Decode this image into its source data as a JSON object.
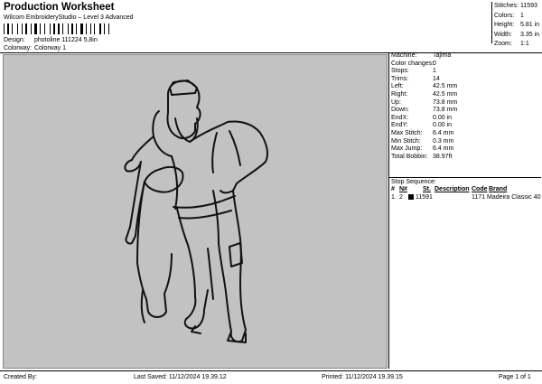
{
  "header": {
    "title": "Production Worksheet",
    "subtitle": "Wilcom EmbroideryStudio – Level 3 Advanced",
    "design_label": "Design:",
    "design_value": "photoline 111224 5,8in",
    "colorway_label": "Colorway:",
    "colorway_value": "Colorway 1"
  },
  "summary": [
    {
      "label": "Stitches:",
      "value": "11593"
    },
    {
      "label": "Colors:",
      "value": "1"
    },
    {
      "label": "Height:",
      "value": "5.81 in"
    },
    {
      "label": "Width:",
      "value": "3.35 in"
    },
    {
      "label": "Zoom:",
      "value": "1:1"
    }
  ],
  "details": [
    {
      "label": "Machine:",
      "value": "Tajima"
    },
    {
      "label": "Color changes:",
      "value": "0"
    },
    {
      "label": "Stops:",
      "value": "1"
    },
    {
      "label": "Trims:",
      "value": "14"
    },
    {
      "label": "Left:",
      "value": "42.5 mm"
    },
    {
      "label": "Right:",
      "value": "42.5 mm"
    },
    {
      "label": "Up:",
      "value": "73.8 mm"
    },
    {
      "label": "Down:",
      "value": "73.8 mm"
    },
    {
      "label": "EndX:",
      "value": "0.00 in"
    },
    {
      "label": "EndY:",
      "value": "0.00 in"
    },
    {
      "label": "Max Stitch:",
      "value": "6.4 mm"
    },
    {
      "label": "Min Stitch:",
      "value": "0.3 mm"
    },
    {
      "label": "Max Jump:",
      "value": "6.4 mm"
    },
    {
      "label": "Total Bobbin:",
      "value": "38.97ft"
    }
  ],
  "stop_sequence": {
    "title": "Stop Sequence:",
    "headers": {
      "num": "#",
      "n": "N#",
      "st": "St.",
      "description": "Description",
      "code": "Code",
      "brand": "Brand"
    },
    "rows": [
      {
        "num": "1.",
        "n": "2",
        "swatch": "#000000",
        "st": "11591",
        "description": "",
        "code": "1171",
        "brand": "Madeira Classic 40"
      }
    ]
  },
  "footer": {
    "created_by": "Created By:",
    "last_saved": "Last Saved: 11/12/2024 19.39.12",
    "printed": "Printed: 11/12/2024 19.39.15",
    "page": "Page 1 of 1"
  }
}
